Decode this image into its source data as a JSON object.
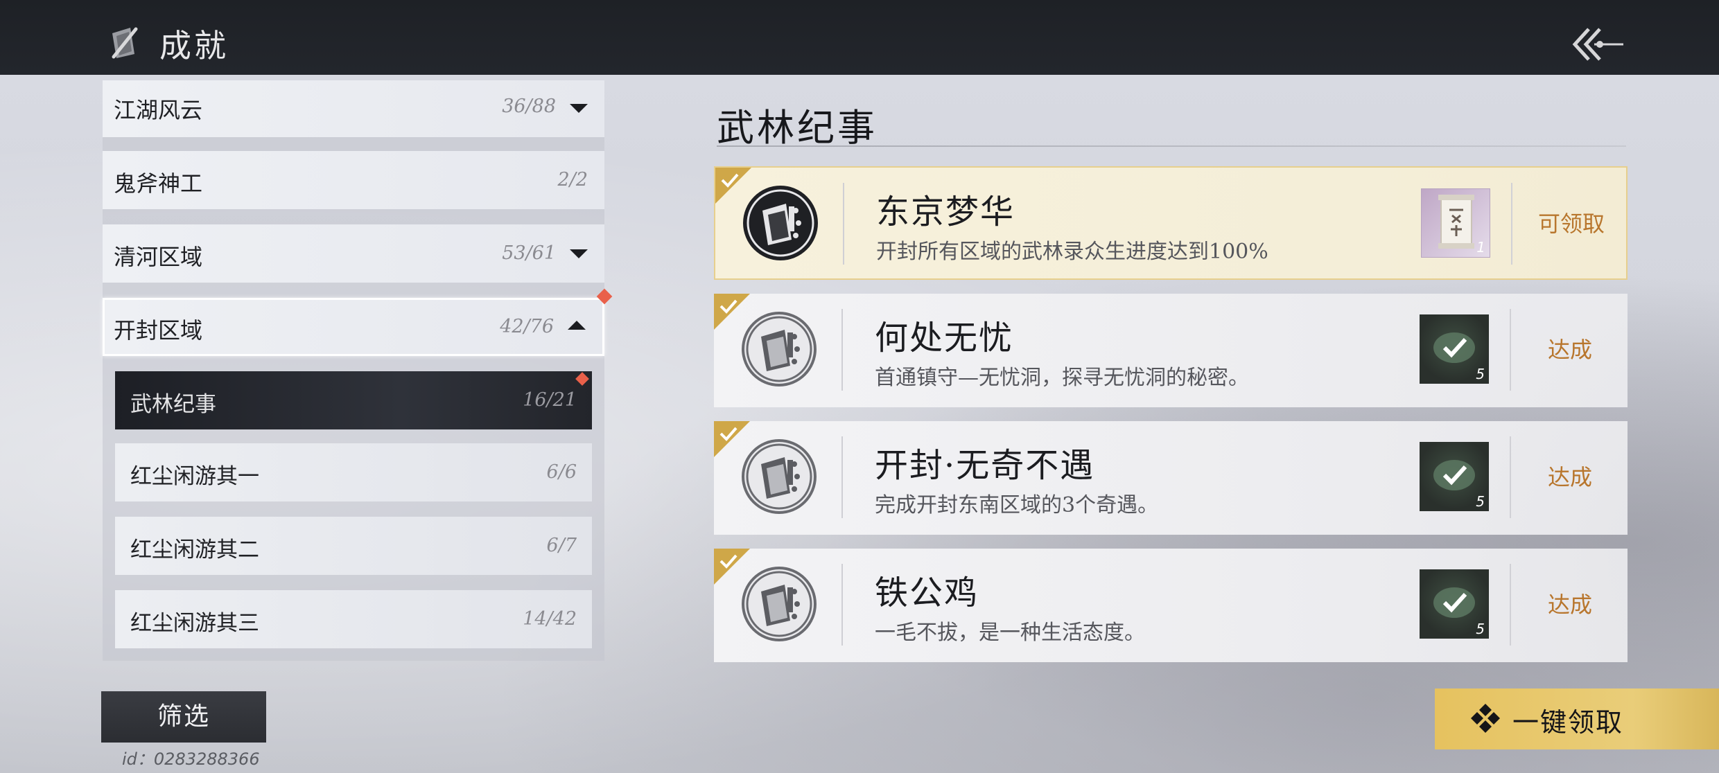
{
  "header": {
    "title": "成就",
    "title_icon": "brush-scroll-icon",
    "back_icon": "double-chevron-back-icon"
  },
  "sidebar": {
    "categories": [
      {
        "label": "江湖风云",
        "count": "36/88",
        "expand": "down"
      },
      {
        "label": "鬼斧神工",
        "count": "2/2"
      },
      {
        "label": "清河区域",
        "count": "53/61",
        "expand": "down"
      },
      {
        "label": "开封区域",
        "count": "42/76",
        "expand": "up",
        "selected": true,
        "has_new": true
      }
    ],
    "subcategories": [
      {
        "label": "武林纪事",
        "count": "16/21",
        "active": true,
        "has_new": true
      },
      {
        "label": "红尘闲游其一",
        "count": "6/6"
      },
      {
        "label": "红尘闲游其二",
        "count": "6/7"
      },
      {
        "label": "红尘闲游其三",
        "count": "14/42"
      }
    ],
    "filter_label": "筛选",
    "uid": "id：0283288366"
  },
  "main": {
    "section_title": "武林纪事",
    "achievements": [
      {
        "name": "东京梦华",
        "desc": "开封所有区域的武林录众生进度达到100%",
        "reward_icon": "scroll-reward-icon",
        "reward_qty": "1",
        "status": "可领取",
        "claimable": true
      },
      {
        "name": "何处无忧",
        "desc": "首通镇守—无忧洞，探寻无忧洞的秘密。",
        "reward_icon": "jade-check-icon",
        "reward_qty": "5",
        "status": "达成"
      },
      {
        "name": "开封·无奇不遇",
        "desc": "完成开封东南区域的3个奇遇。",
        "reward_icon": "jade-check-icon",
        "reward_qty": "5",
        "status": "达成"
      },
      {
        "name": "铁公鸡",
        "desc": "一毛不拔，是一种生活态度。",
        "reward_icon": "jade-check-icon",
        "reward_qty": "5",
        "status": "达成"
      }
    ],
    "claim_all_label": "一键领取"
  },
  "colors": {
    "accent_gold": "#e6c25f",
    "status_text": "#b8762d",
    "new_dot": "#e9604a"
  }
}
